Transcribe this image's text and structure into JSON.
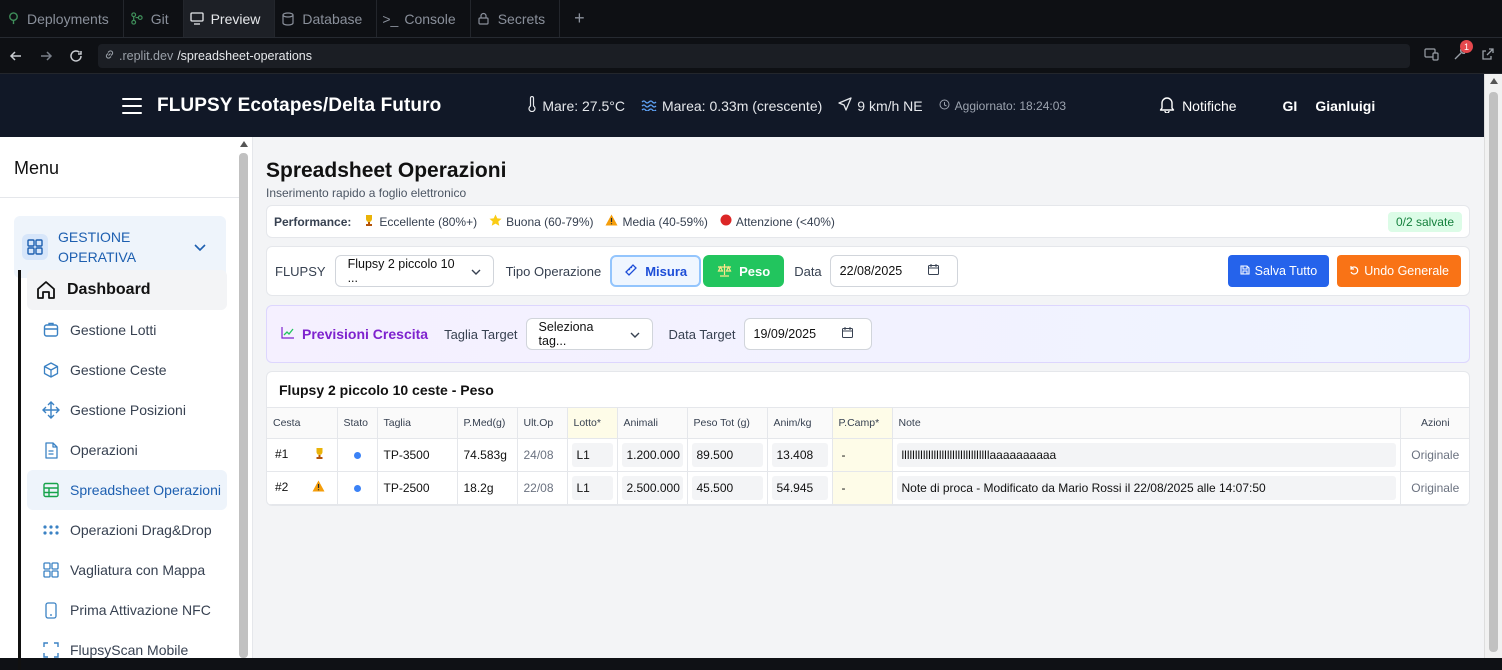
{
  "replit": {
    "tabs": [
      {
        "label": "Deployments",
        "icon": "deployments-icon"
      },
      {
        "label": "Git",
        "icon": "git-icon"
      },
      {
        "label": "Preview",
        "icon": "monitor-icon",
        "active": true
      },
      {
        "label": "Database",
        "icon": "database-icon"
      },
      {
        "label": "Console",
        "icon": "console-icon"
      },
      {
        "label": "Secrets",
        "icon": "lock-icon"
      }
    ],
    "url_host": ".replit.dev",
    "url_path": "/spreadsheet-operations",
    "notification_count": "1"
  },
  "header": {
    "title": "FLUPSY Ecotapes/Delta Futuro",
    "sea_temp": "Mare: 27.5°C",
    "tide": "Marea: 0.33m (crescente)",
    "wind": "9 km/h NE",
    "updated": "Aggiornato: 18:24:03",
    "notifications": "Notifiche",
    "user_initials": "GI",
    "user_name": "Gianluigi"
  },
  "sidebar": {
    "title": "Menu",
    "group": "GESTIONE OPERATIVA",
    "items": [
      {
        "label": "Dashboard",
        "icon": "home-icon"
      },
      {
        "label": "Gestione Lotti",
        "icon": "box-icon"
      },
      {
        "label": "Gestione Ceste",
        "icon": "package-icon"
      },
      {
        "label": "Gestione Posizioni",
        "icon": "move-icon"
      },
      {
        "label": "Operazioni",
        "icon": "document-icon"
      },
      {
        "label": "Spreadsheet Operazioni",
        "icon": "table-icon",
        "active": true
      },
      {
        "label": "Operazioni Drag&Drop",
        "icon": "grip-icon"
      },
      {
        "label": "Vagliatura con Mappa",
        "icon": "grid-icon"
      },
      {
        "label": "Prima Attivazione NFC",
        "icon": "phone-icon"
      },
      {
        "label": "FlupsyScan Mobile",
        "icon": "scan-icon"
      }
    ]
  },
  "page": {
    "title": "Spreadsheet Operazioni",
    "subtitle": "Inserimento rapido a foglio elettronico",
    "performance": {
      "label": "Performance:",
      "items": [
        "Eccellente (80%+)",
        "Buona (60-79%)",
        "Media (40-59%)",
        "Attenzione (<40%)"
      ],
      "saved": "0/2 salvate"
    },
    "controls": {
      "flupsy_label": "FLUPSY",
      "flupsy_value": "Flupsy 2 piccolo 10 ...",
      "tipo_label": "Tipo Operazione",
      "misura": "Misura",
      "peso": "Peso",
      "data_label": "Data",
      "data_value": "22/08/2025",
      "save_all": "Salva Tutto",
      "undo": "Undo Generale"
    },
    "previsioni": {
      "title": "Previsioni Crescita",
      "taglia_label": "Taglia Target",
      "taglia_placeholder": "Seleziona tag...",
      "data_label": "Data Target",
      "data_value": "19/09/2025"
    },
    "grid": {
      "title": "Flupsy 2 piccolo 10 ceste - Peso",
      "columns": [
        "Cesta",
        "Stato",
        "Taglia",
        "P.Med(g)",
        "Ult.Op",
        "Lotto*",
        "Animali",
        "Peso Tot (g)",
        "Anim/kg",
        "P.Camp*",
        "Note",
        "Azioni"
      ],
      "rows": [
        {
          "cesta": "#1",
          "badge": "trophy-icon",
          "taglia": "TP-3500",
          "pmed": "74.583g",
          "ultop": "24/08",
          "lotto": "L1",
          "animali": "1.200.000",
          "peso": "89.500",
          "animkg": "13.408",
          "pcamp": "-",
          "note": "lllllllllllllllllllllllllllllllllaaaaaaaaaa",
          "azioni": "Originale"
        },
        {
          "cesta": "#2",
          "badge": "warning-icon",
          "taglia": "TP-2500",
          "pmed": "18.2g",
          "ultop": "22/08",
          "lotto": "L1",
          "animali": "2.500.000",
          "peso": "45.500",
          "animkg": "54.945",
          "pcamp": "-",
          "note": "Note di proca - Modificato da Mario Rossi il 22/08/2025 alle 14:07:50",
          "azioni": "Originale"
        }
      ]
    }
  }
}
